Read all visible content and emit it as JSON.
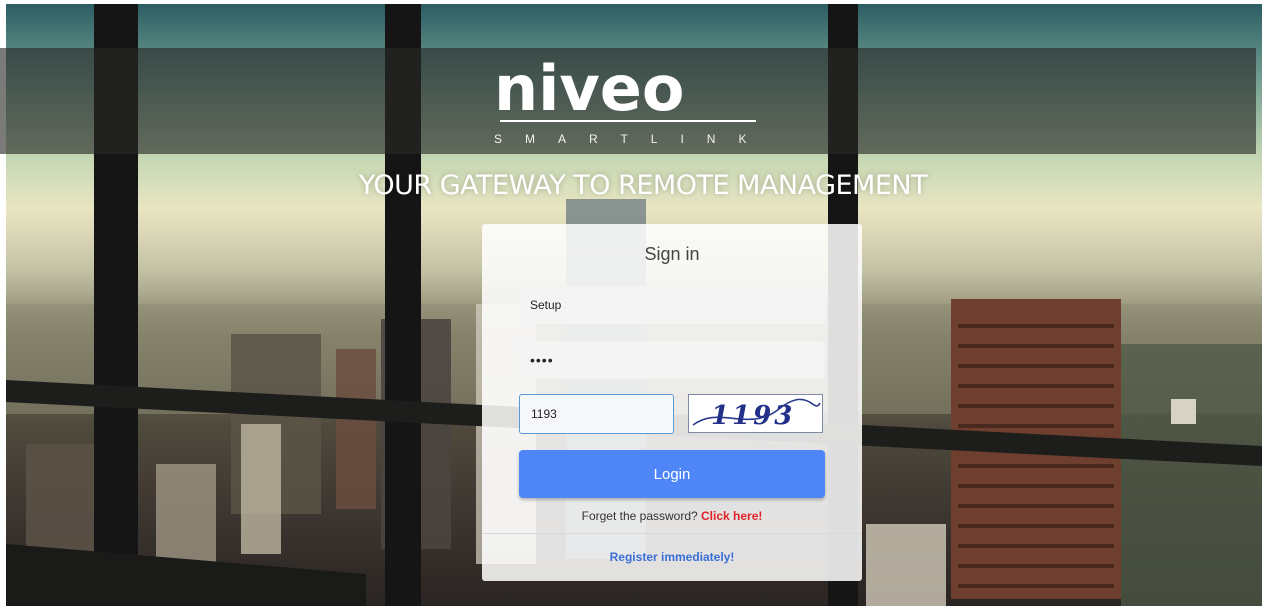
{
  "brand": {
    "name": "niveo",
    "subtitle": "SMARTLINK"
  },
  "tagline": "YOUR GATEWAY TO REMOTE MANAGEMENT",
  "login_form": {
    "title": "Sign in",
    "username_value": "Setup",
    "password_value": "••••",
    "captcha_value": "1193",
    "captcha_image_text": "1193",
    "login_label": "Login",
    "forget_text": "Forget the password?",
    "forget_link": "Click here!",
    "register_link": "Register immediately!"
  },
  "colors": {
    "primary_button": "#4f86f7",
    "link_red": "#e2232a",
    "link_blue": "#3b6fd8"
  }
}
